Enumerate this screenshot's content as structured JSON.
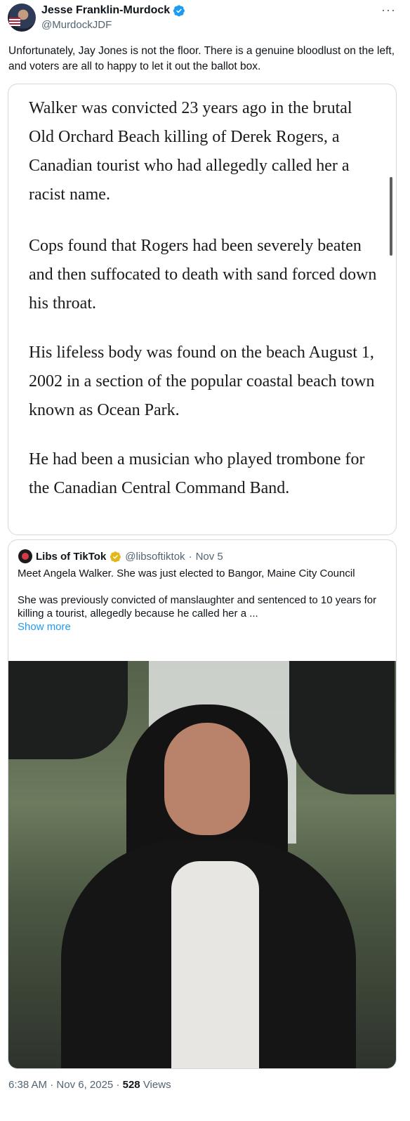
{
  "author": {
    "display_name": "Jesse Franklin-Murdock",
    "handle": "@MurdockJDF",
    "verified_color": "#1d9bf0"
  },
  "tweet": {
    "text": "Unfortunately, Jay Jones is not the floor. There is a genuine bloodlust on the left, and voters are all to happy to let it out the ballot box."
  },
  "embedded_article": {
    "paragraphs": [
      "Walker was convicted 23 years ago in the brutal Old Orchard Beach killing of Derek Rogers, a Canadian tourist who had allegedly called her a racist name.",
      "Cops found that Rogers had been severely beaten and then suffocated to death with sand forced down his throat.",
      "His lifeless body was found on the beach August 1, 2002 in a section of the popular coastal beach town known as Ocean Park.",
      "He had been a musician who played trombone for the Canadian Central Command Band."
    ]
  },
  "quoted_tweet": {
    "name": "Libs of TikTok",
    "handle": "@libsoftiktok",
    "separator": "·",
    "date": "Nov 5",
    "badge_color": "#e2b719",
    "line1": "Meet Angela Walker. She was just elected to Bangor, Maine City Council",
    "line2": "She was previously convicted of manslaughter and sentenced to 10 years for killing a tourist, allegedly because he called her a ...",
    "show_more": "Show more"
  },
  "meta": {
    "time": "6:38 AM",
    "sep1": "·",
    "date": "Nov 6, 2025",
    "sep2": "·",
    "views_count": "528",
    "views_label": "Views"
  },
  "more_icon": "···"
}
